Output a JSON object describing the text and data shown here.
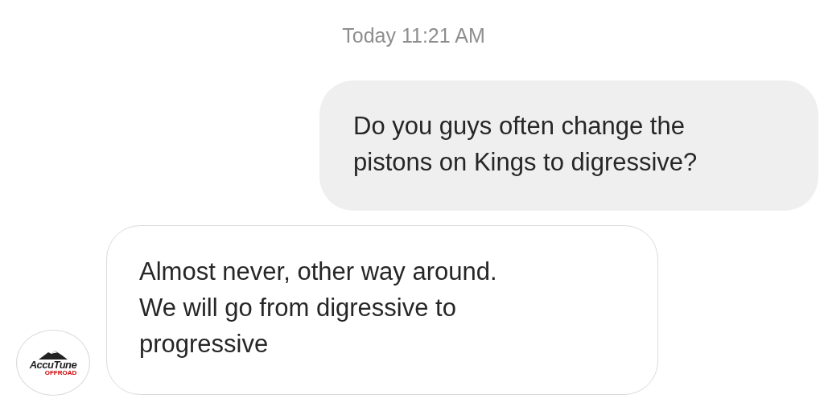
{
  "timestamp": "Today 11:21 AM",
  "messages": [
    {
      "kind": "outgoing",
      "lines": [
        "Do you guys often change the",
        "pistons on Kings to digressive?"
      ]
    },
    {
      "kind": "incoming",
      "lines": [
        "Almost never, other way around.",
        "We will go from digressive to",
        "progressive"
      ],
      "avatar": {
        "logo_text": "AccuTune",
        "logo_subtext": "OFFROAD"
      }
    }
  ]
}
